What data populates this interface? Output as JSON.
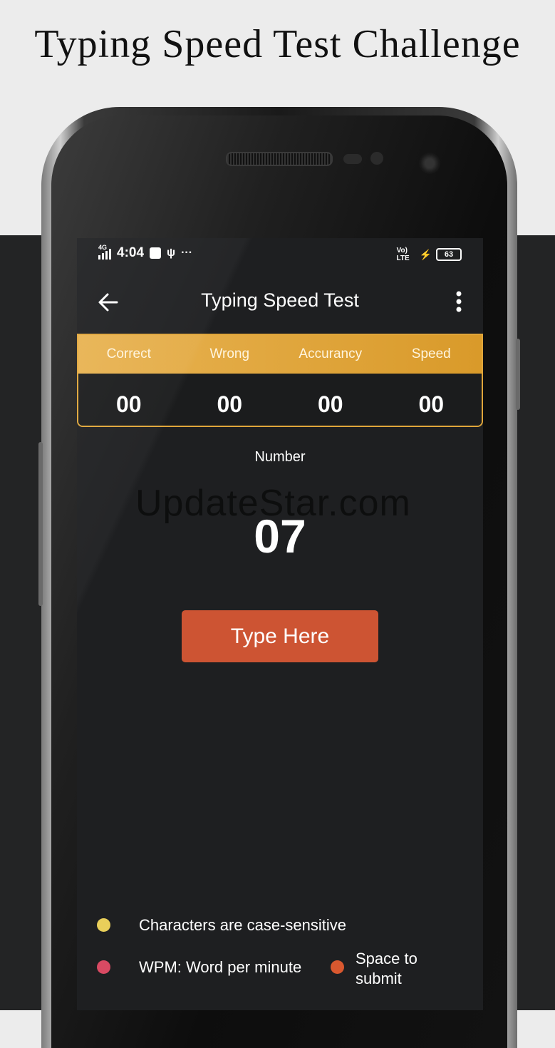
{
  "promo": {
    "title": "Typing Speed Test Challenge"
  },
  "status_bar": {
    "network": "4G",
    "time": "4:04",
    "right_label": "Vo) LTE",
    "battery": "63"
  },
  "app_bar": {
    "title": "Typing Speed Test"
  },
  "stats": {
    "headers": [
      "Correct",
      "Wrong",
      "Accurancy",
      "Speed"
    ],
    "values": [
      "00",
      "00",
      "00",
      "00"
    ]
  },
  "test": {
    "mode": "Number",
    "target": "07",
    "watermark": "UpdateStar.com"
  },
  "button": {
    "label": "Type Here"
  },
  "hints": [
    {
      "text": "Characters are case-sensitive",
      "color": "#e9cf5a"
    },
    {
      "text": "WPM: Word per minute",
      "color": "#d94a63"
    },
    {
      "text": "Space to submit",
      "color": "#d9582f"
    }
  ],
  "colors": {
    "accent": "#e0a63a",
    "button": "#cd5433",
    "screen_bg": "#1e1f21"
  }
}
